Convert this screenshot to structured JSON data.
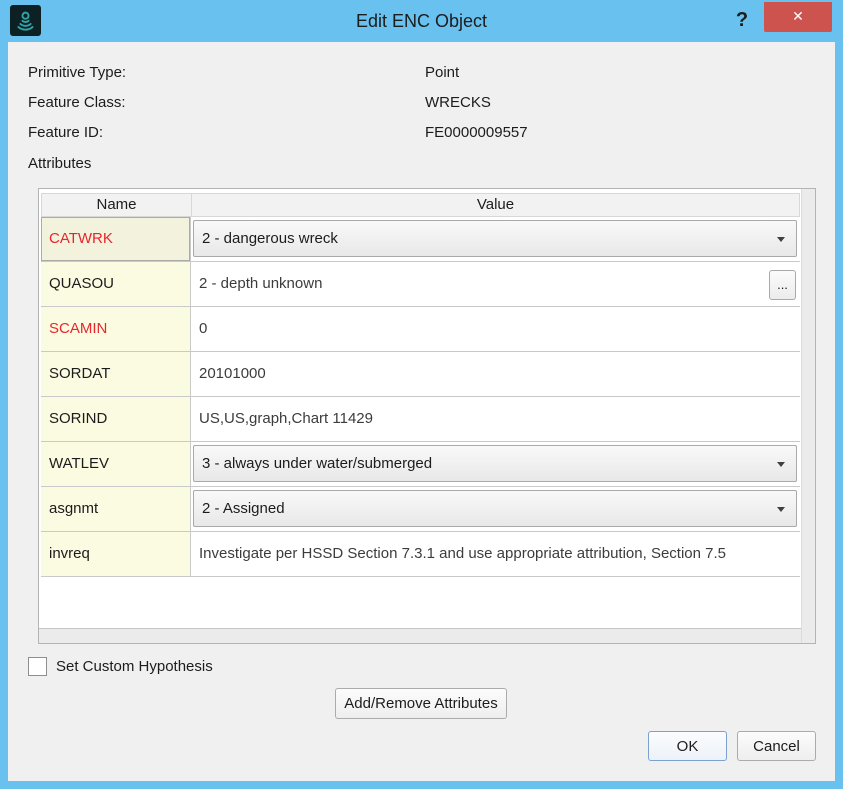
{
  "window": {
    "title": "Edit ENC Object",
    "help_label": "?",
    "close_glyph": "✕"
  },
  "info_fields": [
    {
      "label": "Primitive Type:",
      "value": "Point"
    },
    {
      "label": "Feature Class:",
      "value": "WRECKS"
    },
    {
      "label": "Feature ID:",
      "value": "FE0000009557"
    }
  ],
  "attributes_label": "Attributes",
  "table": {
    "columns": [
      "Name",
      "Value"
    ],
    "ellipsis_button_label": "...",
    "rows": [
      {
        "name": "CATWRK",
        "value": "2 - dangerous wreck",
        "type": "dropdown",
        "name_red": true,
        "selected": true
      },
      {
        "name": "QUASOU",
        "value": "2 - depth unknown",
        "type": "text-with-ellipsis-button",
        "name_red": false
      },
      {
        "name": "SCAMIN",
        "value": "0",
        "type": "text",
        "name_red": true
      },
      {
        "name": "SORDAT",
        "value": "20101000",
        "type": "text",
        "name_red": false
      },
      {
        "name": "SORIND",
        "value": "US,US,graph,Chart 11429",
        "type": "text",
        "name_red": false
      },
      {
        "name": "WATLEV",
        "value": "3 - always under water/submerged",
        "type": "dropdown",
        "name_red": false
      },
      {
        "name": "asgnmt",
        "value": "2 - Assigned",
        "type": "dropdown",
        "name_red": false
      },
      {
        "name": "invreq",
        "value": "Investigate per HSSD Section 7.3.1 and use appropriate attribution, Section 7.5",
        "type": "text",
        "name_red": false
      }
    ]
  },
  "footer": {
    "checkbox_label": "Set Custom Hypothesis",
    "checkbox_checked": false,
    "add_remove_label": "Add/Remove Attributes",
    "ok_label": "OK",
    "cancel_label": "Cancel"
  },
  "colors": {
    "titlebar_blue": "#68c1ef",
    "close_red": "#cd534e",
    "dialog_bg": "#f0f0f0",
    "name_cell_bg": "#fbfbe1",
    "name_cell_selected_bg": "#f2f2dd",
    "red_text": "#e8262d",
    "ok_border": "#7aa2d0",
    "icon_teal": "#2fa3a8"
  }
}
